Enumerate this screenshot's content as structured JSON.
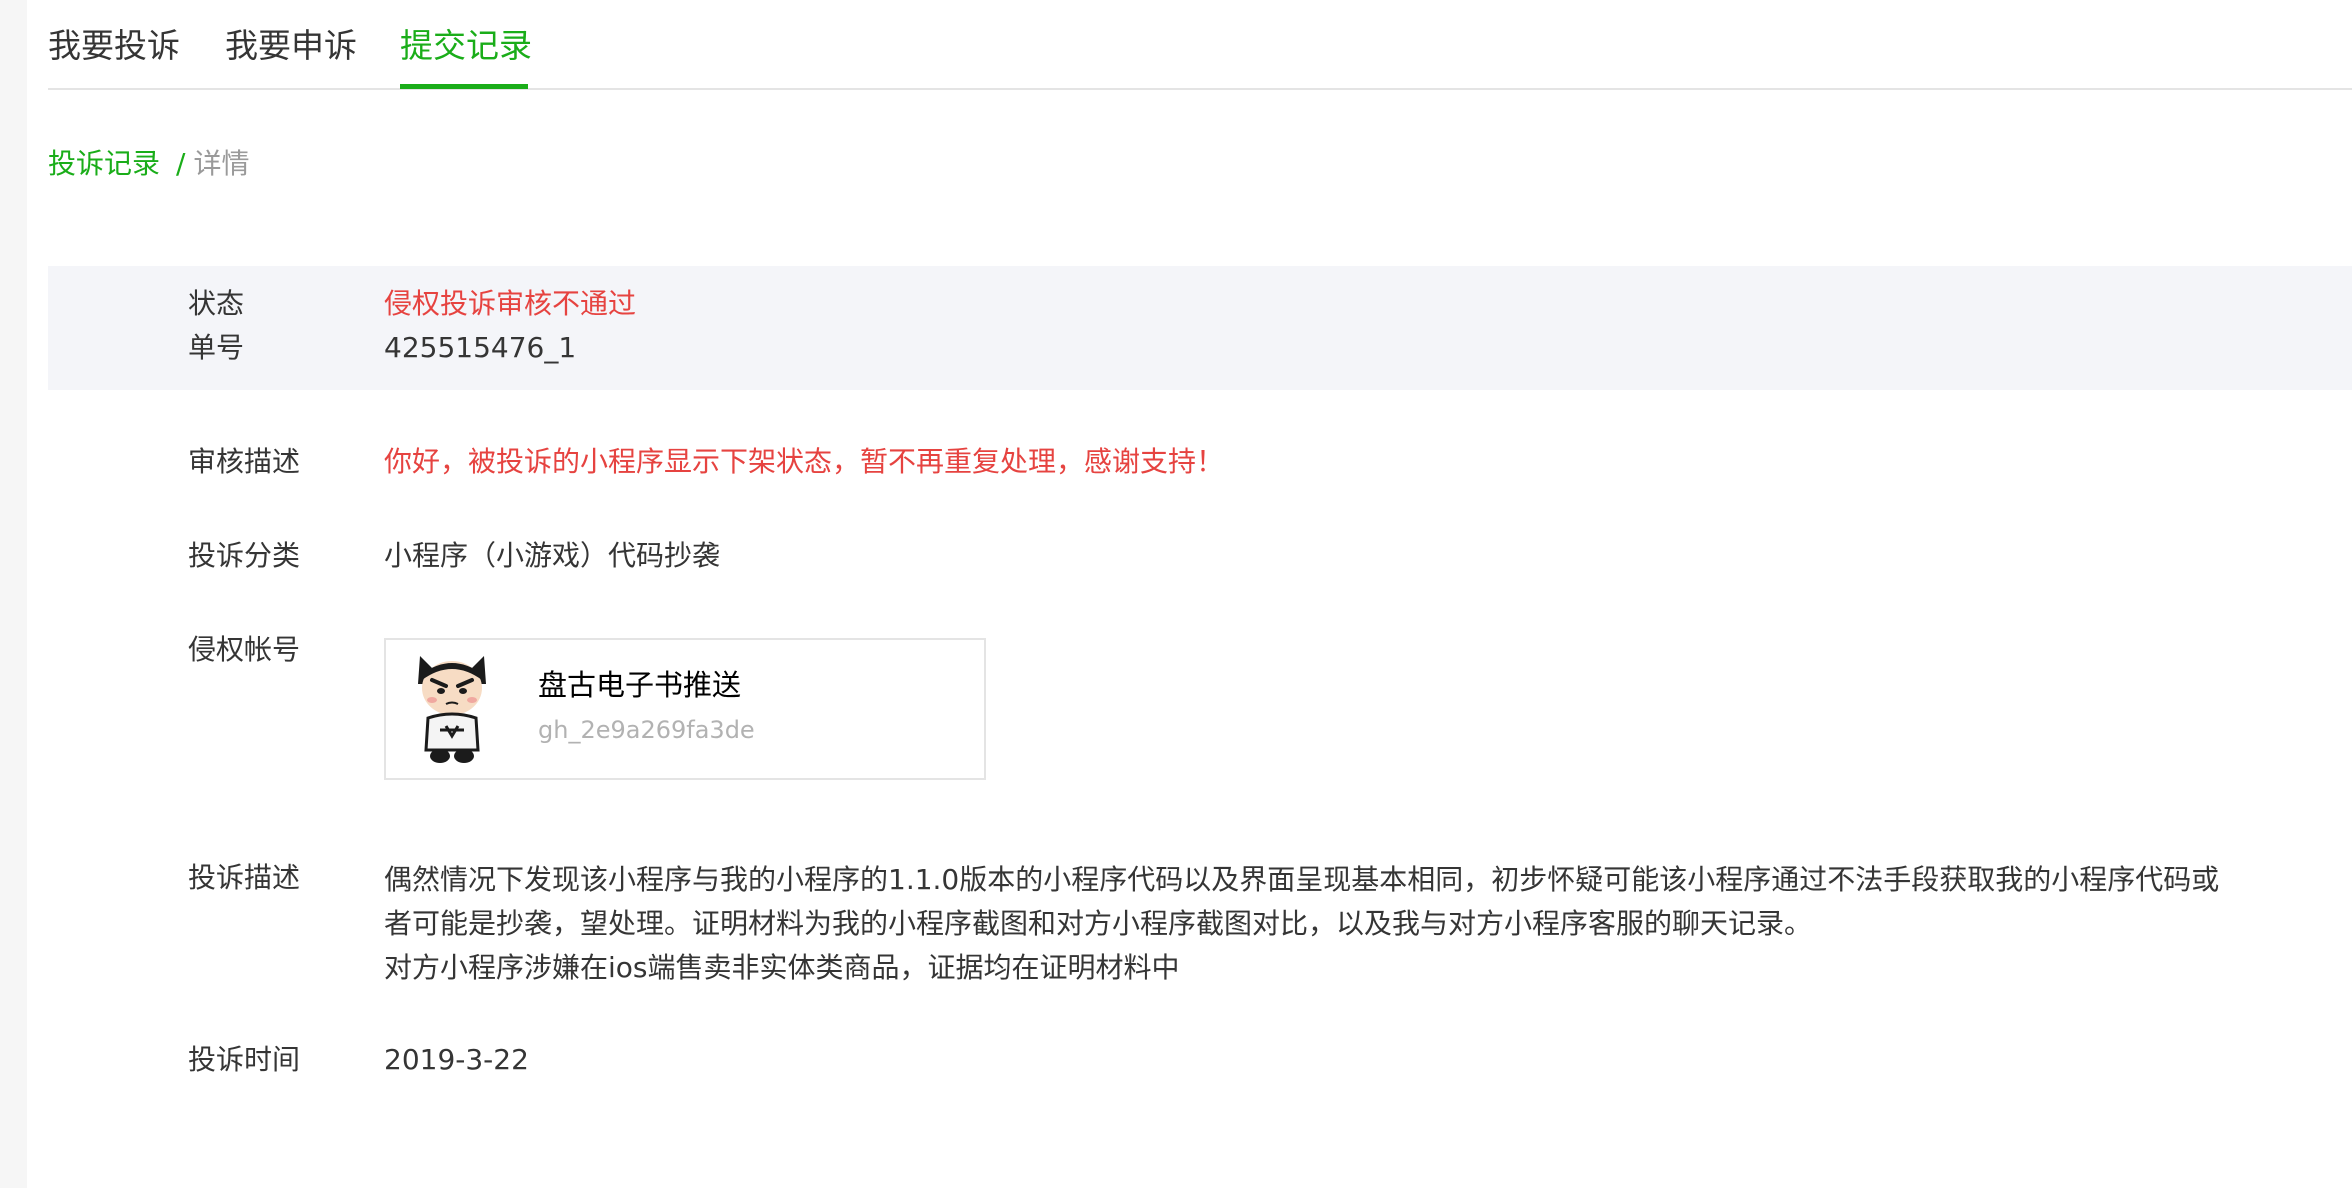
{
  "tabs": [
    {
      "label": "我要投诉"
    },
    {
      "label": "我要申诉"
    },
    {
      "label": "提交记录",
      "active": true
    }
  ],
  "breadcrumb": {
    "parent": "投诉记录",
    "separator": "/",
    "current": "详情"
  },
  "status": {
    "label": "状态",
    "value": "侵权投诉审核不通过"
  },
  "order": {
    "label": "单号",
    "value": "425515476_1"
  },
  "review": {
    "label": "审核描述",
    "value": "你好，被投诉的小程序显示下架状态，暂不再重复处理，感谢支持！"
  },
  "category": {
    "label": "投诉分类",
    "value": "小程序（小游戏）代码抄袭"
  },
  "account": {
    "label": "侵权帐号",
    "name": "盘古电子书推送",
    "id": "gh_2e9a269fa3de",
    "avatar_icon": "cartoon-avatar-icon"
  },
  "description": {
    "label": "投诉描述",
    "lines": [
      "偶然情况下发现该小程序与我的小程序的1.1.0版本的小程序代码以及界面呈现基本相同，初步怀疑可能该小程序通过不法手段获取我的小程序代码或",
      "者可能是抄袭，望处理。证明材料为我的小程序截图和对方小程序截图对比，以及我与对方小程序客服的聊天记录。",
      "对方小程序涉嫌在ios端售卖非实体类商品，证据均在证明材料中"
    ]
  },
  "time": {
    "label": "投诉时间",
    "value": "2019-3-22"
  },
  "colors": {
    "accent": "#1aad19",
    "error": "#e64340",
    "panel": "#f4f5f9"
  }
}
